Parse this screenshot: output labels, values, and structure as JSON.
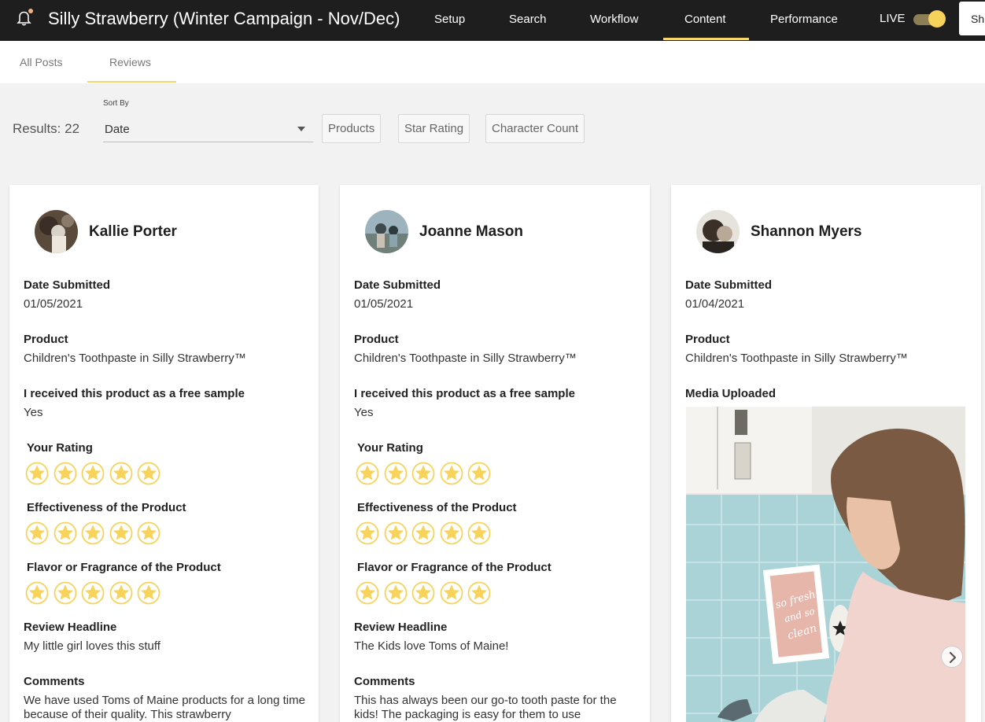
{
  "header": {
    "title": "Silly Strawberry (Winter Campaign - Nov/Dec)",
    "nav": [
      {
        "label": "Setup"
      },
      {
        "label": "Search"
      },
      {
        "label": "Workflow"
      },
      {
        "label": "Content",
        "active": true
      },
      {
        "label": "Performance"
      }
    ],
    "live_label": "LIVE",
    "live_on": true,
    "share_label": "Sh"
  },
  "subtabs": [
    {
      "label": "All Posts"
    },
    {
      "label": "Reviews",
      "active": true
    }
  ],
  "filters": {
    "results": "Results: 22",
    "sort_by_label": "Sort By",
    "sort_value": "Date",
    "buttons": [
      "Products",
      "Star Rating",
      "Character Count"
    ]
  },
  "labels": {
    "date_submitted": "Date Submitted",
    "product": "Product",
    "free_sample": "I received this product as a free sample",
    "your_rating": "Your Rating",
    "effectiveness": "Effectiveness of the Product",
    "flavor": "Flavor or Fragrance of the Product",
    "review_headline": "Review Headline",
    "comments": "Comments",
    "media_uploaded": "Media Uploaded"
  },
  "reviews": [
    {
      "name": "Kallie Porter",
      "date": "01/05/2021",
      "product": "Children's Toothpaste in Silly Strawberry™",
      "free_sample": "Yes",
      "your_rating": 5,
      "effectiveness": 5,
      "flavor": 5,
      "headline": "My little girl loves this stuff",
      "comment": "We have used Toms of Maine products for a long time because of their quality. This strawberry"
    },
    {
      "name": "Joanne Mason",
      "date": "01/05/2021",
      "product": "Children's Toothpaste in Silly Strawberry™",
      "free_sample": "Yes",
      "your_rating": 5,
      "effectiveness": 5,
      "flavor": 5,
      "headline": "The Kids love Toms of Maine!",
      "comment": "This has always been our go-to tooth paste for the kids! The packaging is easy for them to use"
    },
    {
      "name": "Shannon Myers",
      "date": "01/04/2021",
      "product": "Children's Toothpaste in Silly Strawberry™",
      "media_text": "so fresh and so clean"
    }
  ],
  "colors": {
    "accent": "#f5d76e",
    "star_fill": "#f7d35c",
    "topbar": "#1e1e1e"
  }
}
